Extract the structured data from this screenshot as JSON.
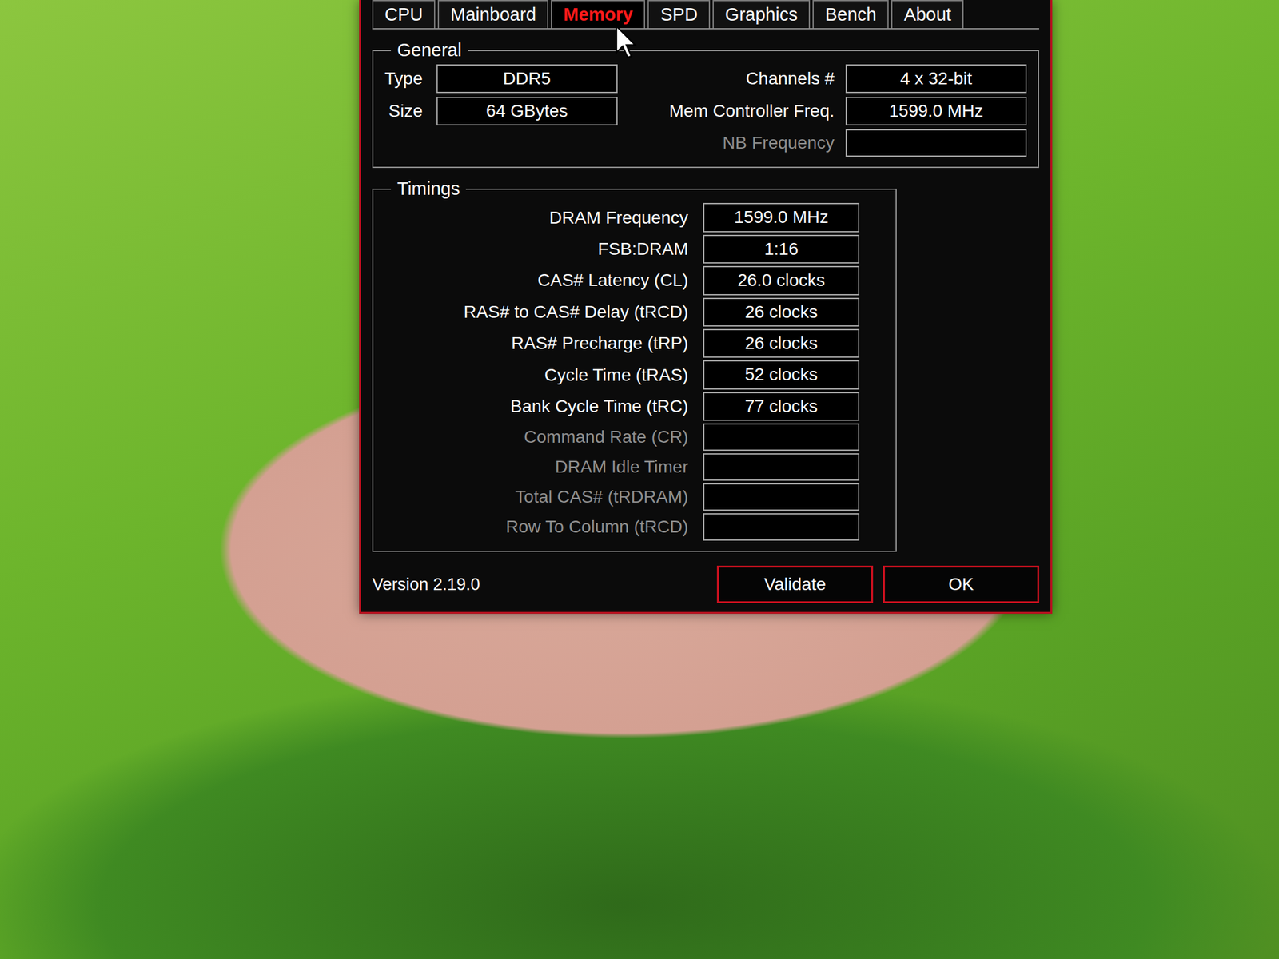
{
  "tabs": [
    {
      "label": "CPU",
      "selected": false
    },
    {
      "label": "Mainboard",
      "selected": false
    },
    {
      "label": "Memory",
      "selected": true
    },
    {
      "label": "SPD",
      "selected": false
    },
    {
      "label": "Graphics",
      "selected": false
    },
    {
      "label": "Bench",
      "selected": false
    },
    {
      "label": "About",
      "selected": false
    }
  ],
  "general": {
    "title": "General",
    "left_fields": [
      {
        "label": "Type",
        "value": "DDR5",
        "disabled": false
      },
      {
        "label": "Size",
        "value": "64 GBytes",
        "disabled": false
      }
    ],
    "right_fields": [
      {
        "label": "Channels #",
        "value": "4 x 32-bit",
        "disabled": false
      },
      {
        "label": "Mem Controller Freq.",
        "value": "1599.0 MHz",
        "disabled": false
      },
      {
        "label": "NB Frequency",
        "value": "",
        "disabled": true
      }
    ]
  },
  "timings": {
    "title": "Timings",
    "rows": [
      {
        "label": "DRAM Frequency",
        "value": "1599.0 MHz",
        "disabled": false
      },
      {
        "label": "FSB:DRAM",
        "value": "1:16",
        "disabled": false
      },
      {
        "label": "CAS# Latency (CL)",
        "value": "26.0 clocks",
        "disabled": false
      },
      {
        "label": "RAS# to CAS# Delay (tRCD)",
        "value": "26 clocks",
        "disabled": false
      },
      {
        "label": "RAS# Precharge (tRP)",
        "value": "26 clocks",
        "disabled": false
      },
      {
        "label": "Cycle Time (tRAS)",
        "value": "52 clocks",
        "disabled": false
      },
      {
        "label": "Bank Cycle Time (tRC)",
        "value": "77 clocks",
        "disabled": false
      },
      {
        "label": "Command Rate (CR)",
        "value": "",
        "disabled": true
      },
      {
        "label": "DRAM Idle Timer",
        "value": "",
        "disabled": true
      },
      {
        "label": "Total CAS# (tRDRAM)",
        "value": "",
        "disabled": true
      },
      {
        "label": "Row To Column (tRCD)",
        "value": "",
        "disabled": true
      }
    ]
  },
  "version": "Version 2.19.0",
  "buttons": [
    "Validate",
    "OK"
  ]
}
